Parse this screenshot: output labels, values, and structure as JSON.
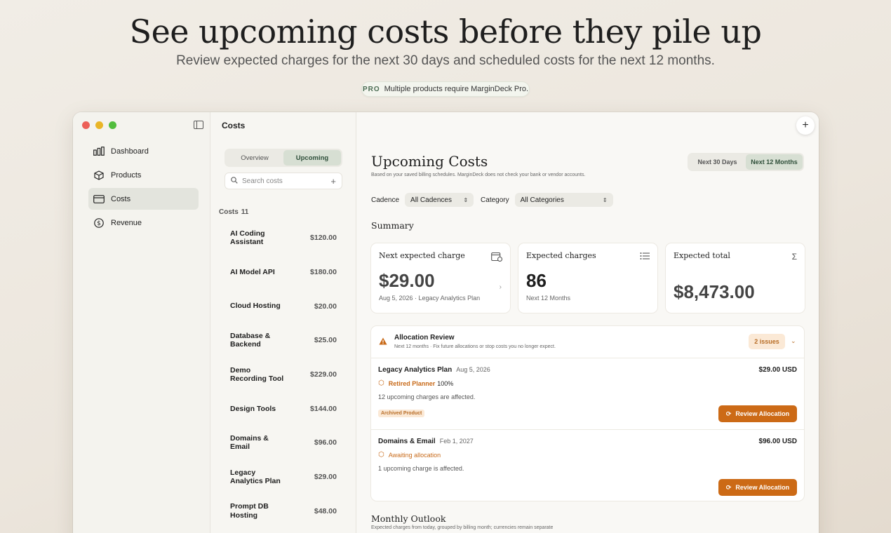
{
  "hero": {
    "title": "See upcoming costs before they pile up",
    "subtitle": "Review expected charges for the next 30 days and scheduled costs for the next 12 months.",
    "pro_badge": "PRO",
    "pro_text": "Multiple products require MarginDeck Pro."
  },
  "sidebar": {
    "items": [
      {
        "label": "Dashboard",
        "icon": "bar-chart-icon"
      },
      {
        "label": "Products",
        "icon": "cube-icon"
      },
      {
        "label": "Costs",
        "icon": "credit-card-icon",
        "active": true
      },
      {
        "label": "Revenue",
        "icon": "dollar-circle-icon"
      }
    ]
  },
  "list": {
    "title": "Costs",
    "tabs": [
      "Overview",
      "Upcoming"
    ],
    "active_tab": "Upcoming",
    "search_placeholder": "Search costs",
    "section_label": "Costs",
    "count": "11",
    "items": [
      {
        "name": "AI Coding Assistant",
        "amount": "$120.00"
      },
      {
        "name": "AI Model API",
        "amount": "$180.00"
      },
      {
        "name": "Cloud Hosting",
        "amount": "$20.00"
      },
      {
        "name": "Database & Backend",
        "amount": "$25.00"
      },
      {
        "name": "Demo Recording Tool",
        "amount": "$229.00"
      },
      {
        "name": "Design Tools",
        "amount": "$144.00"
      },
      {
        "name": "Domains & Email",
        "amount": "$96.00"
      },
      {
        "name": "Legacy Analytics Plan",
        "amount": "$29.00"
      },
      {
        "name": "Prompt DB Hosting",
        "amount": "$48.00"
      }
    ]
  },
  "main": {
    "title": "Upcoming Costs",
    "subtitle": "Based on your saved billing schedules. MarginDeck does not check your bank or vendor accounts.",
    "range_options": [
      "Next 30 Days",
      "Next 12 Months"
    ],
    "active_range": "Next 12 Months",
    "filters": {
      "cadence_label": "Cadence",
      "cadence_value": "All Cadences",
      "category_label": "Category",
      "category_value": "All Categories"
    },
    "summary_heading": "Summary",
    "cards": {
      "next": {
        "title": "Next expected charge",
        "value": "$29.00",
        "meta": "Aug 5, 2026 · Legacy Analytics Plan"
      },
      "count": {
        "title": "Expected charges",
        "value": "86",
        "meta": "Next 12 Months"
      },
      "total": {
        "title": "Expected total",
        "value": "$8,473.00",
        "icon": "Σ"
      }
    },
    "allocation": {
      "title": "Allocation Review",
      "subtitle": "Next 12 months · Fix future allocations or stop costs you no longer expect.",
      "issues": "2 issues",
      "items": [
        {
          "name": "Legacy Analytics Plan",
          "date": "Aug 5, 2026",
          "amount": "$29.00 USD",
          "product": "Retired Planner",
          "percent": "100%",
          "affected": "12 upcoming charges are affected.",
          "tag": "Archived Product",
          "action": "Review Allocation"
        },
        {
          "name": "Domains & Email",
          "date": "Feb 1, 2027",
          "amount": "$96.00 USD",
          "product": "Awaiting allocation",
          "affected": "1 upcoming charge is affected.",
          "action": "Review Allocation"
        }
      ]
    },
    "outlook_heading": "Monthly Outlook",
    "outlook_sub": "Expected charges from today, grouped by billing month; currencies remain separate"
  },
  "colors": {
    "accent_green": "#d7dfd3",
    "warning_orange": "#cc6a16"
  }
}
